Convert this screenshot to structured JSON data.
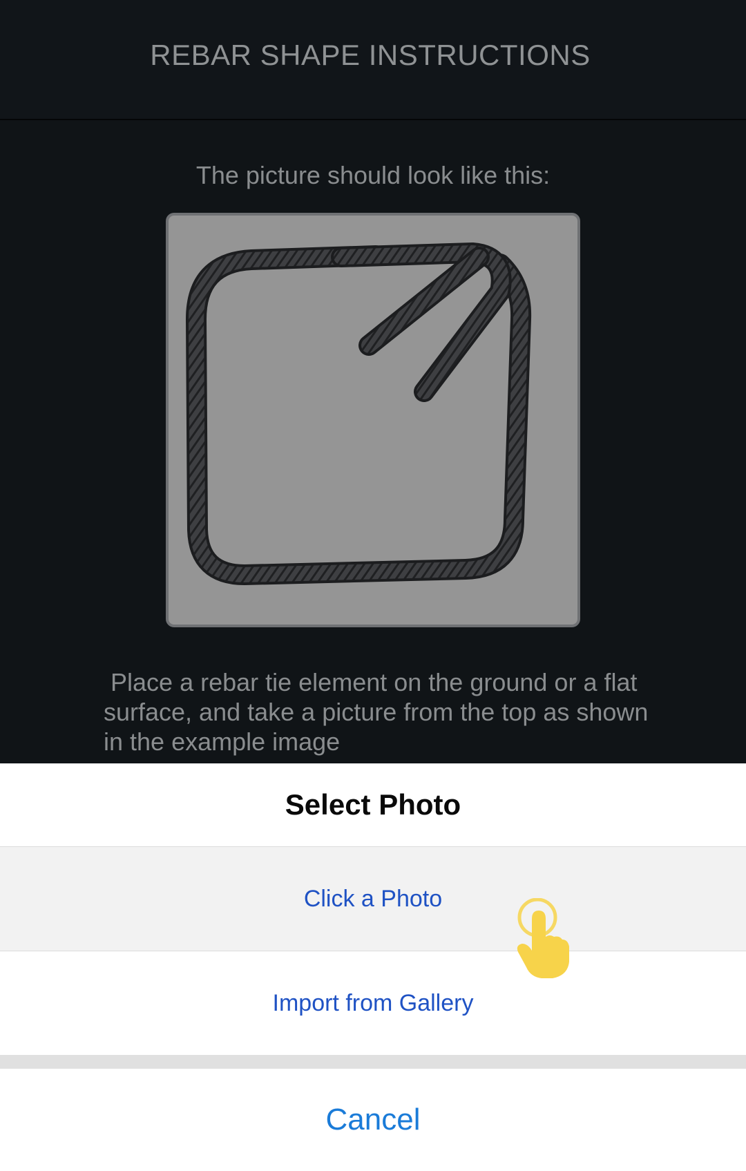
{
  "header": {
    "title": "REBAR SHAPE INSTRUCTIONS"
  },
  "example": {
    "caption": "The picture should look like this:",
    "image_icon": "rebar-tie-example-image"
  },
  "instructions": {
    "text": " Place a rebar tie element on the ground or a flat surface, and take a picture from the top as shown in the example image"
  },
  "action_sheet": {
    "title": "Select Photo",
    "options": [
      {
        "label": "Click a Photo"
      },
      {
        "label": "Import from Gallery"
      }
    ],
    "cancel_label": "Cancel"
  },
  "overlay": {
    "gesture_icon": "tap-hand-icon",
    "gesture_color": "#f7d34a"
  },
  "colors": {
    "header_bg": "#111519",
    "screen_bg": "#101417",
    "option_text": "#1f52c4",
    "cancel_text": "#1a7bd8",
    "highlight_row": "#f2f2f2"
  }
}
